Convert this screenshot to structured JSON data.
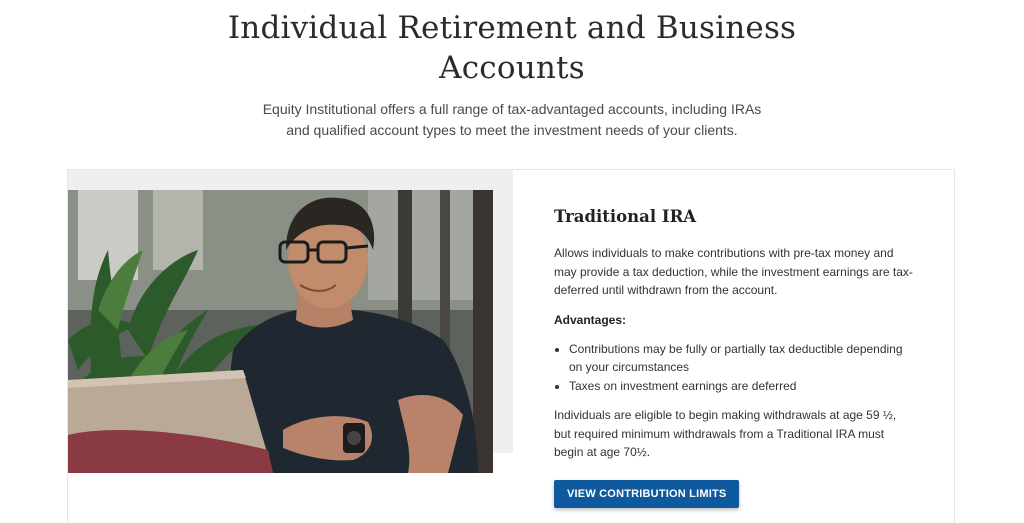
{
  "hero": {
    "title": "Individual Retirement and Business Accounts",
    "intro": "Equity Institutional offers a full range of tax-advantaged accounts, including IRAs and qualified account types to meet the investment needs of your clients."
  },
  "card": {
    "title": "Traditional IRA",
    "description": "Allows individuals to make contributions with pre-tax money and may provide a tax deduction, while the investment earnings are tax-deferred until withdrawn from the account.",
    "advantages_label": "Advantages:",
    "advantages": [
      "Contributions may be fully or partially tax deductible depending on your circumstances",
      "Taxes on investment earnings are deferred"
    ],
    "withdrawal_text": "Individuals are eligible to begin making withdrawals at age 59 ½, but required minimum withdrawals from a Traditional IRA must begin at age 70½.",
    "cta_label": "VIEW CONTRIBUTION LIMITS"
  },
  "colors": {
    "cta_background": "#0f5a9e",
    "photo_panel": "#efefef"
  }
}
